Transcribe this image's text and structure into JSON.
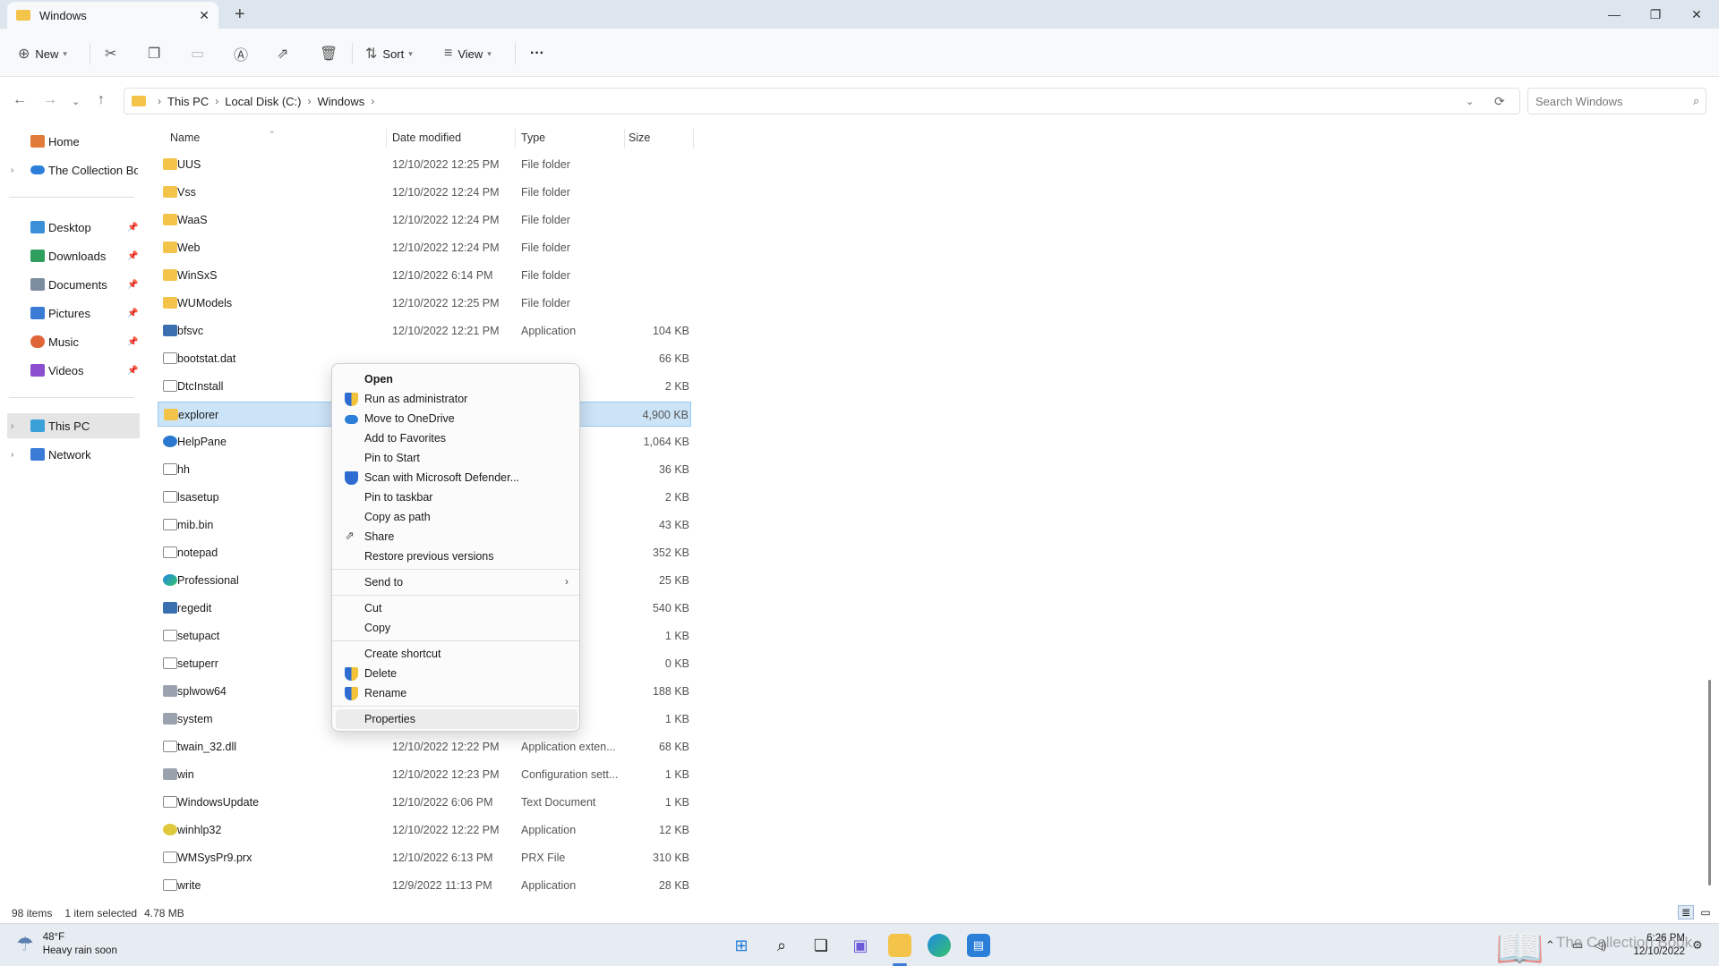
{
  "window": {
    "tab_title": "Windows",
    "tab_close": "✕",
    "new_tab": "+",
    "minimize": "—",
    "maximize": "❐",
    "close": "✕"
  },
  "toolbar": {
    "new_label": "New",
    "sort_label": "Sort",
    "view_label": "View",
    "more_label": "···"
  },
  "address": {
    "crumbs": [
      "This PC",
      "Local Disk (C:)",
      "Windows"
    ],
    "search_placeholder": "Search Windows"
  },
  "sidebar": {
    "home": "Home",
    "collection": "The Collection Boo",
    "quick": [
      {
        "label": "Desktop",
        "color": "#3a8fd8"
      },
      {
        "label": "Downloads",
        "color": "#2f9e5e"
      },
      {
        "label": "Documents",
        "color": "#7c8da0"
      },
      {
        "label": "Pictures",
        "color": "#3a7bd5"
      },
      {
        "label": "Music",
        "color": "#e0663a"
      },
      {
        "label": "Videos",
        "color": "#8b4fcf"
      }
    ],
    "this_pc": "This PC",
    "network": "Network"
  },
  "columns": {
    "name": "Name",
    "date": "Date modified",
    "type": "Type",
    "size": "Size"
  },
  "files": [
    {
      "name": "UUS",
      "date": "12/10/2022 12:25 PM",
      "type": "File folder",
      "size": "",
      "icon": "folder"
    },
    {
      "name": "Vss",
      "date": "12/10/2022 12:24 PM",
      "type": "File folder",
      "size": "",
      "icon": "folder"
    },
    {
      "name": "WaaS",
      "date": "12/10/2022 12:24 PM",
      "type": "File folder",
      "size": "",
      "icon": "folder"
    },
    {
      "name": "Web",
      "date": "12/10/2022 12:24 PM",
      "type": "File folder",
      "size": "",
      "icon": "folder"
    },
    {
      "name": "WinSxS",
      "date": "12/10/2022 6:14 PM",
      "type": "File folder",
      "size": "",
      "icon": "folder"
    },
    {
      "name": "WUModels",
      "date": "12/10/2022 12:25 PM",
      "type": "File folder",
      "size": "",
      "icon": "folder"
    },
    {
      "name": "bfsvc",
      "date": "12/10/2022 12:21 PM",
      "type": "Application",
      "size": "104 KB",
      "icon": "app"
    },
    {
      "name": "bootstat.dat",
      "date": "",
      "type": "",
      "size": "66 KB",
      "icon": "file"
    },
    {
      "name": "DtcInstall",
      "date": "",
      "type": "ent",
      "size": "2 KB",
      "icon": "file"
    },
    {
      "name": "explorer",
      "date": "",
      "type": "",
      "size": "4,900 KB",
      "icon": "folder",
      "selected": true
    },
    {
      "name": "HelpPane",
      "date": "",
      "type": "",
      "size": "1,064 KB",
      "icon": "help"
    },
    {
      "name": "hh",
      "date": "",
      "type": "",
      "size": "36 KB",
      "icon": "file"
    },
    {
      "name": "lsasetup",
      "date": "",
      "type": "ent",
      "size": "2 KB",
      "icon": "file"
    },
    {
      "name": "mib.bin",
      "date": "",
      "type": "",
      "size": "43 KB",
      "icon": "file"
    },
    {
      "name": "notepad",
      "date": "",
      "type": "",
      "size": "352 KB",
      "icon": "file"
    },
    {
      "name": "Professional",
      "date": "",
      "type": "ge H...",
      "size": "25 KB",
      "icon": "edge"
    },
    {
      "name": "regedit",
      "date": "",
      "type": "",
      "size": "540 KB",
      "icon": "app"
    },
    {
      "name": "setupact",
      "date": "",
      "type": "ent",
      "size": "1 KB",
      "icon": "file"
    },
    {
      "name": "setuperr",
      "date": "",
      "type": "ent",
      "size": "0 KB",
      "icon": "file"
    },
    {
      "name": "splwow64",
      "date": "",
      "type": "",
      "size": "188 KB",
      "icon": "gear"
    },
    {
      "name": "system",
      "date": "",
      "type": "n sett...",
      "size": "1 KB",
      "icon": "gear"
    },
    {
      "name": "twain_32.dll",
      "date": "12/10/2022 12:22 PM",
      "type": "Application exten...",
      "size": "68 KB",
      "icon": "file"
    },
    {
      "name": "win",
      "date": "12/10/2022 12:23 PM",
      "type": "Configuration sett...",
      "size": "1 KB",
      "icon": "gear"
    },
    {
      "name": "WindowsUpdate",
      "date": "12/10/2022 6:06 PM",
      "type": "Text Document",
      "size": "1 KB",
      "icon": "file"
    },
    {
      "name": "winhlp32",
      "date": "12/10/2022 12:22 PM",
      "type": "Application",
      "size": "12 KB",
      "icon": "bulb"
    },
    {
      "name": "WMSysPr9.prx",
      "date": "12/10/2022 6:13 PM",
      "type": "PRX File",
      "size": "310 KB",
      "icon": "file"
    },
    {
      "name": "write",
      "date": "12/9/2022 11:13 PM",
      "type": "Application",
      "size": "28 KB",
      "icon": "file"
    }
  ],
  "context_menu": [
    {
      "label": "Open",
      "bold": true,
      "icon": ""
    },
    {
      "label": "Run as administrator",
      "icon": "shield"
    },
    {
      "label": "Move to OneDrive",
      "icon": "cloud"
    },
    {
      "label": "Add to Favorites",
      "icon": ""
    },
    {
      "label": "Pin to Start",
      "icon": ""
    },
    {
      "label": "Scan with Microsoft Defender...",
      "icon": "defender"
    },
    {
      "label": "Pin to taskbar",
      "icon": ""
    },
    {
      "label": "Copy as path",
      "icon": ""
    },
    {
      "label": "Share",
      "icon": "share"
    },
    {
      "label": "Restore previous versions",
      "icon": ""
    },
    {
      "label": "Send to",
      "icon": "",
      "submenu": true
    },
    {
      "label": "Cut",
      "icon": ""
    },
    {
      "label": "Copy",
      "icon": ""
    },
    {
      "label": "Create shortcut",
      "icon": ""
    },
    {
      "label": "Delete",
      "icon": "shield"
    },
    {
      "label": "Rename",
      "icon": "shield"
    },
    {
      "label": "Properties",
      "icon": "",
      "hover": true
    }
  ],
  "status": {
    "items": "98 items",
    "selected": "1 item selected",
    "size": "4.78 MB"
  },
  "taskbar": {
    "temp": "48°F",
    "forecast": "Heavy rain soon",
    "time": "6:26 PM",
    "date": "12/10/2022",
    "watermark": "The Collection Book"
  }
}
